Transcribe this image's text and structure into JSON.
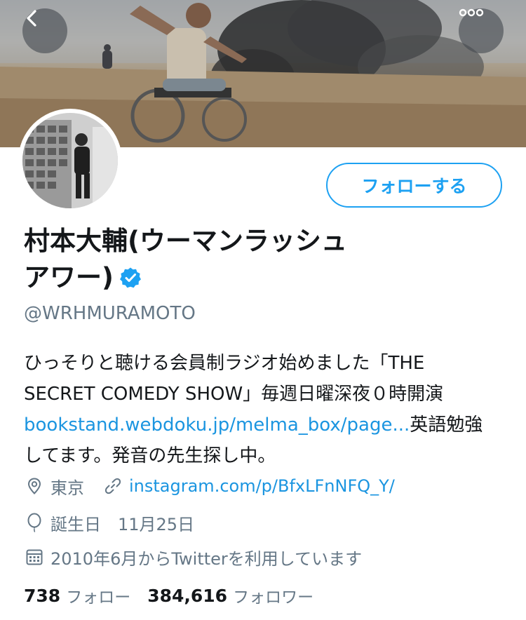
{
  "header": {
    "back_icon": "chevron-left-icon",
    "more_icon": "ellipsis-icon"
  },
  "profile": {
    "name_line1": "村本大輔(ウーマンラッシュ",
    "name_line2": "アワー)",
    "verified_icon": "verified-badge-icon",
    "handle": "@WRHMURAMOTO",
    "follow_button": "フォローする"
  },
  "bio": {
    "line1": "ひっそりと聴ける会員制ラジオ始めました「THE",
    "line2": "SECRET COMEDY SHOW」毎週日曜深夜０時開演",
    "link": "bookstand.webdoku.jp/melma_box/page...",
    "after_link": "英語勉強",
    "line4": "してます。発音の先生探し中。"
  },
  "meta": {
    "location": "東京",
    "website": "instagram.com/p/BfxLFnNFQ_Y/",
    "birthday": "誕生日　11月25日",
    "joined": "2010年6月からTwitterを利用しています"
  },
  "stats": {
    "following_count": "738",
    "following_label": "フォロー",
    "followers_count": "384,616",
    "followers_label": "フォロワー"
  },
  "colors": {
    "accent": "#1da1f2",
    "link": "#1b95e0",
    "secondary_text": "#657786"
  }
}
